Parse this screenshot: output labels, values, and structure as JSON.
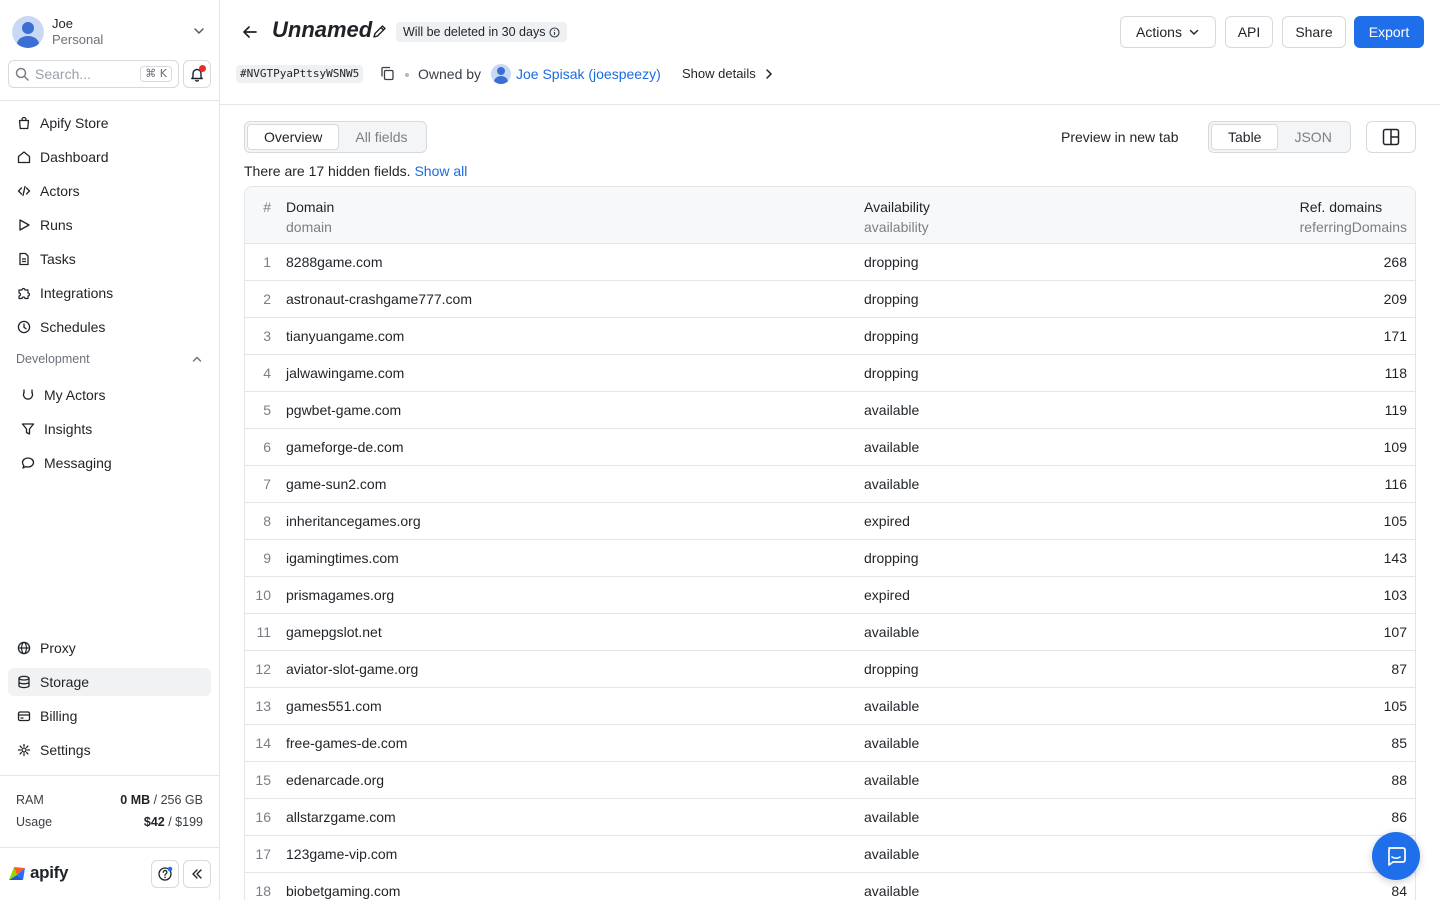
{
  "user": {
    "name": "Joe",
    "plan": "Personal"
  },
  "search": {
    "placeholder": "Search...",
    "shortcut": "⌘ K"
  },
  "nav": {
    "items": [
      {
        "label": "Apify Store",
        "icon": "bag-icon"
      },
      {
        "label": "Dashboard",
        "icon": "home-icon"
      },
      {
        "label": "Actors",
        "icon": "code-icon"
      },
      {
        "label": "Runs",
        "icon": "play-icon"
      },
      {
        "label": "Tasks",
        "icon": "document-icon"
      },
      {
        "label": "Integrations",
        "icon": "puzzle-icon"
      },
      {
        "label": "Schedules",
        "icon": "clock-icon"
      }
    ],
    "section": "Development",
    "dev_items": [
      {
        "label": "My Actors",
        "icon": "actor-icon"
      },
      {
        "label": "Insights",
        "icon": "funnel-icon"
      },
      {
        "label": "Messaging",
        "icon": "chat-bubble-icon"
      }
    ],
    "bottom_items": [
      {
        "label": "Proxy",
        "icon": "globe-icon"
      },
      {
        "label": "Storage",
        "icon": "database-icon"
      },
      {
        "label": "Billing",
        "icon": "card-icon"
      },
      {
        "label": "Settings",
        "icon": "gear-icon"
      }
    ],
    "active": "Storage"
  },
  "usage": {
    "ram_label": "RAM",
    "ram_used": "0 MB",
    "ram_total": "/ 256 GB",
    "usage_label": "Usage",
    "usage_used": "$42",
    "usage_total": "/ $199"
  },
  "brand": {
    "name": "apify"
  },
  "header": {
    "title": "Unnamed",
    "delete_badge": "Will be deleted in 30 days",
    "dataset_id": "#NVGTPyaPttsyWSNW5",
    "owned_by": "Owned by",
    "owner": "Joe Spisak (joespeezy)",
    "show_details": "Show details"
  },
  "actions": {
    "actions": "Actions",
    "api": "API",
    "share": "Share",
    "export": "Export"
  },
  "toolbar": {
    "overview": "Overview",
    "all_fields": "All fields",
    "preview": "Preview in new tab",
    "table": "Table",
    "json": "JSON"
  },
  "hidden": {
    "text": "There are 17 hidden fields.",
    "link": "Show all"
  },
  "table": {
    "columns": {
      "index": "#",
      "domain": "Domain",
      "domain_key": "domain",
      "availability": "Availability",
      "availability_key": "availability",
      "ref": "Ref. domains",
      "ref_key": "referringDomains"
    },
    "rows": [
      {
        "n": "1",
        "domain": "8288game.com",
        "availability": "dropping",
        "ref": "268"
      },
      {
        "n": "2",
        "domain": "astronaut-crashgame777.com",
        "availability": "dropping",
        "ref": "209"
      },
      {
        "n": "3",
        "domain": "tianyuangame.com",
        "availability": "dropping",
        "ref": "171"
      },
      {
        "n": "4",
        "domain": "jalwawingame.com",
        "availability": "dropping",
        "ref": "118"
      },
      {
        "n": "5",
        "domain": "pgwbet-game.com",
        "availability": "available",
        "ref": "119"
      },
      {
        "n": "6",
        "domain": "gameforge-de.com",
        "availability": "available",
        "ref": "109"
      },
      {
        "n": "7",
        "domain": "game-sun2.com",
        "availability": "available",
        "ref": "116"
      },
      {
        "n": "8",
        "domain": "inheritancegames.org",
        "availability": "expired",
        "ref": "105"
      },
      {
        "n": "9",
        "domain": "igamingtimes.com",
        "availability": "dropping",
        "ref": "143"
      },
      {
        "n": "10",
        "domain": "prismagames.org",
        "availability": "expired",
        "ref": "103"
      },
      {
        "n": "11",
        "domain": "gamepgslot.net",
        "availability": "available",
        "ref": "107"
      },
      {
        "n": "12",
        "domain": "aviator-slot-game.org",
        "availability": "dropping",
        "ref": "87"
      },
      {
        "n": "13",
        "domain": "games551.com",
        "availability": "available",
        "ref": "105"
      },
      {
        "n": "14",
        "domain": "free-games-de.com",
        "availability": "available",
        "ref": "85"
      },
      {
        "n": "15",
        "domain": "edenarcade.org",
        "availability": "available",
        "ref": "88"
      },
      {
        "n": "16",
        "domain": "allstarzgame.com",
        "availability": "available",
        "ref": "86"
      },
      {
        "n": "17",
        "domain": "123game-vip.com",
        "availability": "available",
        "ref": ""
      },
      {
        "n": "18",
        "domain": "biobetgaming.com",
        "availability": "available",
        "ref": "84"
      }
    ]
  },
  "colors": {
    "accent": "#1f6feb",
    "link": "#1a6de0",
    "notification": "#e0322b"
  }
}
